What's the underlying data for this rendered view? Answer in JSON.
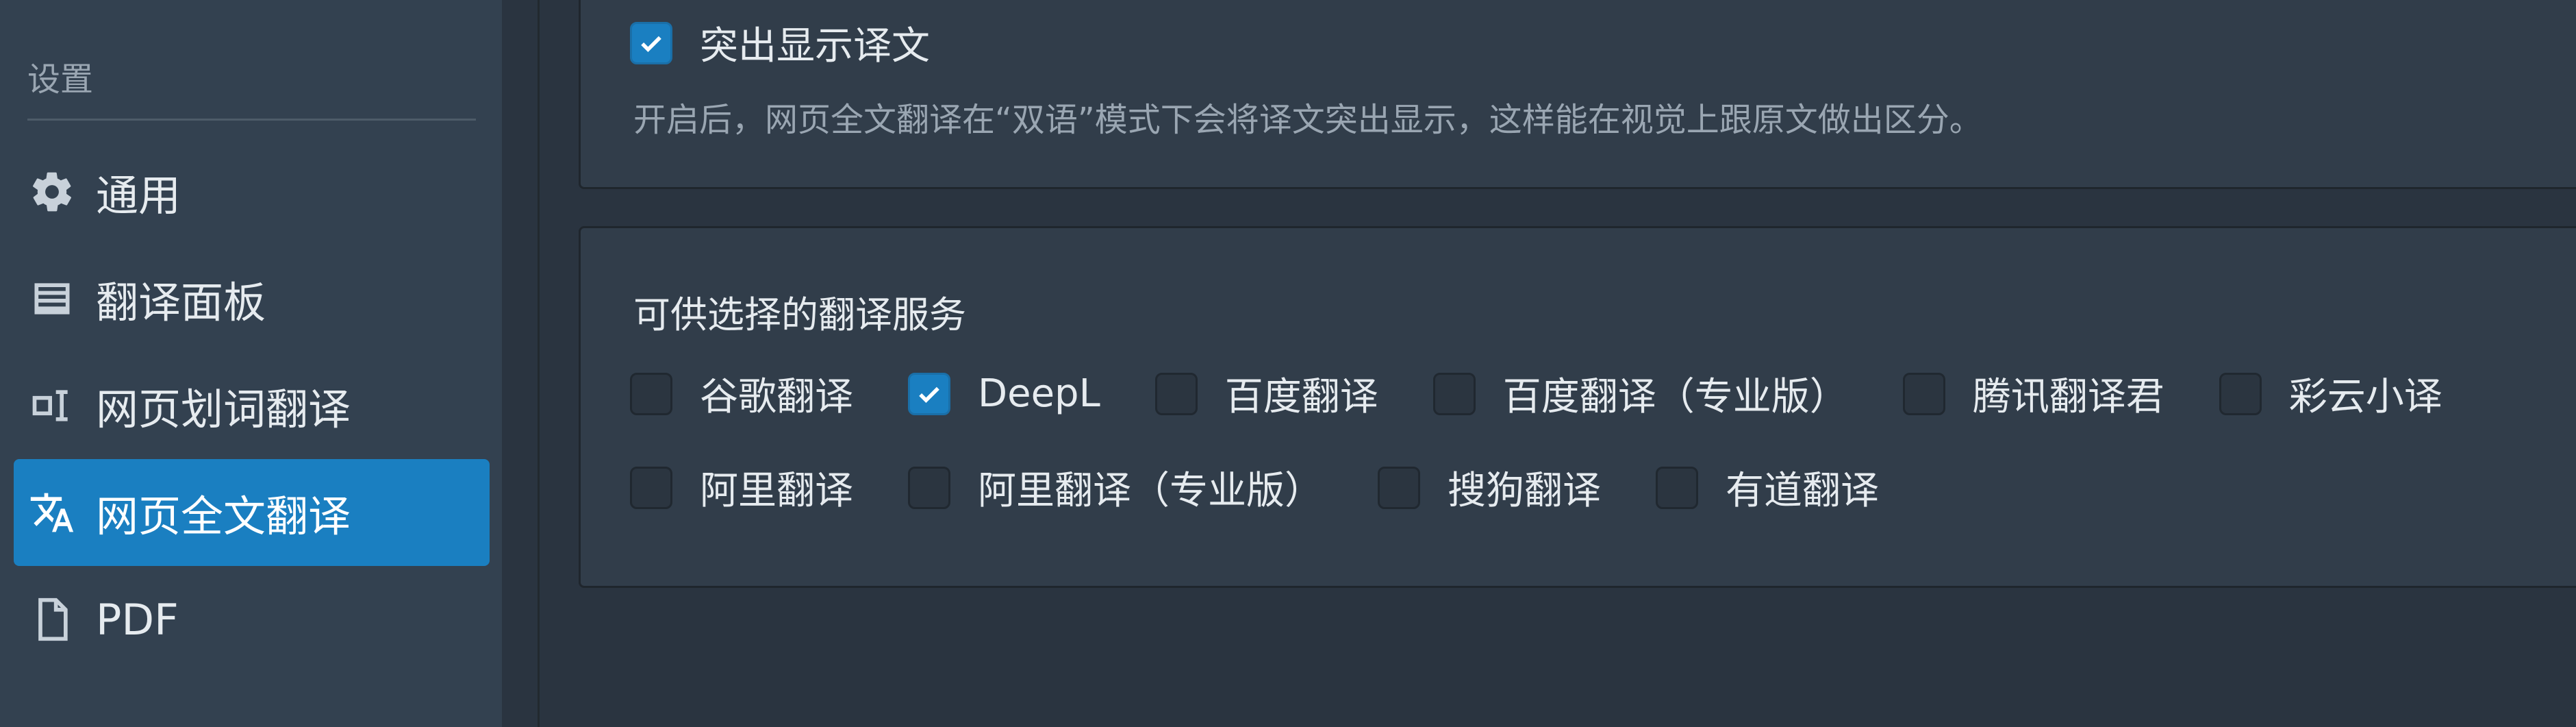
{
  "sidebar": {
    "heading": "设置",
    "items": [
      {
        "label": "通用",
        "icon": "gear-icon",
        "active": false
      },
      {
        "label": "翻译面板",
        "icon": "panel-icon",
        "active": false
      },
      {
        "label": "网页划词翻译",
        "icon": "text-select-icon",
        "active": false
      },
      {
        "label": "网页全文翻译",
        "icon": "translate-icon",
        "active": true
      },
      {
        "label": "PDF",
        "icon": "file-icon",
        "active": false
      }
    ]
  },
  "highlight": {
    "label": "突出显示译文",
    "checked": true,
    "help": "开启后，网页全文翻译在“双语”模式下会将译文突出显示，这样能在视觉上跟原文做出区分。"
  },
  "services": {
    "title": "可供选择的翻译服务",
    "options": [
      {
        "label": "谷歌翻译",
        "checked": false
      },
      {
        "label": "DeepL",
        "checked": true
      },
      {
        "label": "百度翻译",
        "checked": false
      },
      {
        "label": "百度翻译（专业版）",
        "checked": false
      },
      {
        "label": "腾讯翻译君",
        "checked": false
      },
      {
        "label": "彩云小译",
        "checked": false
      },
      {
        "label": "阿里翻译",
        "checked": false
      },
      {
        "label": "阿里翻译（专业版）",
        "checked": false
      },
      {
        "label": "搜狗翻译",
        "checked": false
      },
      {
        "label": "有道翻译",
        "checked": false
      }
    ]
  },
  "colors": {
    "accent": "#1a7fc1",
    "sidebar_bg": "#334150",
    "main_bg": "#2a3440",
    "card_bg": "#313d4a"
  }
}
